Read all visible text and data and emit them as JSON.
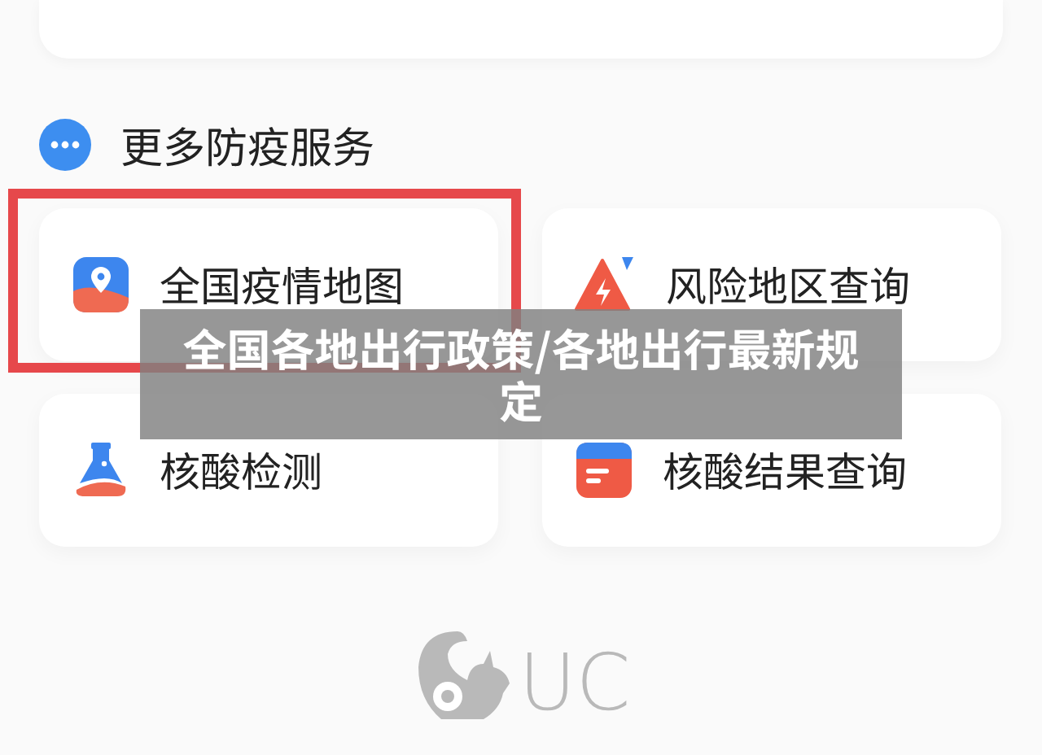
{
  "section": {
    "title": "更多防疫服务"
  },
  "services": [
    {
      "label": "全国疫情地图",
      "kind": "map",
      "highlighted": true
    },
    {
      "label": "风险地区查询",
      "kind": "alert",
      "highlighted": false
    },
    {
      "label": "核酸检测",
      "kind": "flask",
      "highlighted": false
    },
    {
      "label": "核酸结果查询",
      "kind": "form",
      "highlighted": false
    }
  ],
  "caption": {
    "text": "全国各地出行政策/各地出行最新规定"
  },
  "footer": {
    "logo_text": "UC"
  }
}
